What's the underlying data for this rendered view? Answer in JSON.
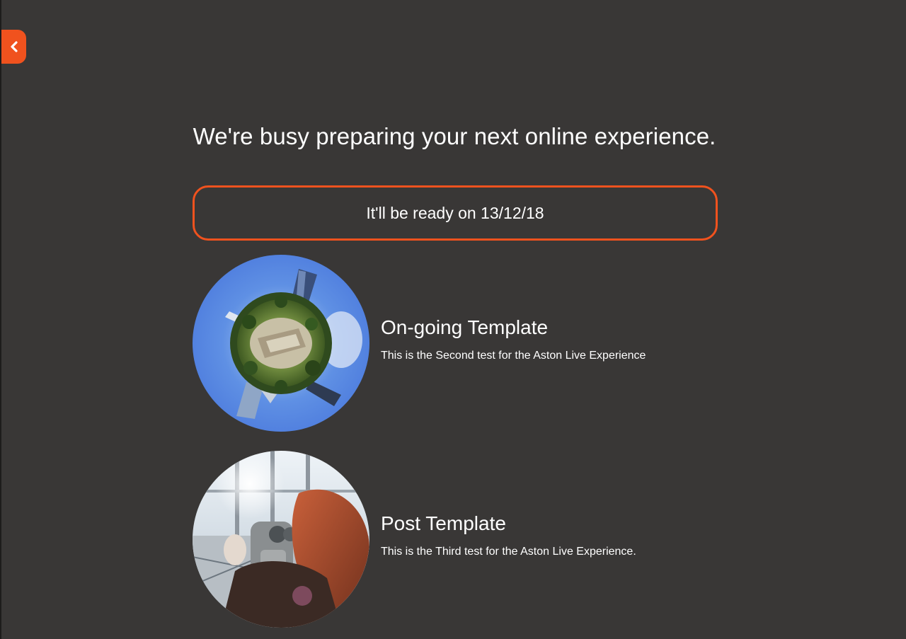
{
  "back_button": {
    "icon": "chevron-left-icon",
    "color": "#f0521e"
  },
  "headline": "We're busy preparing your next online experience.",
  "ready_notice": "It'll be ready on 13/12/18",
  "templates": [
    {
      "title": "On-going Template",
      "description": "This is the Second test for the Aston Live Experience",
      "image": "tiny-planet-city-photo"
    },
    {
      "title": "Post Template",
      "description": "This is the Third test for the Aston Live Experience.",
      "image": "observation-deck-binoculars-photo"
    }
  ],
  "colors": {
    "background": "#393736",
    "accent": "#f0521e",
    "text": "#ffffff"
  }
}
